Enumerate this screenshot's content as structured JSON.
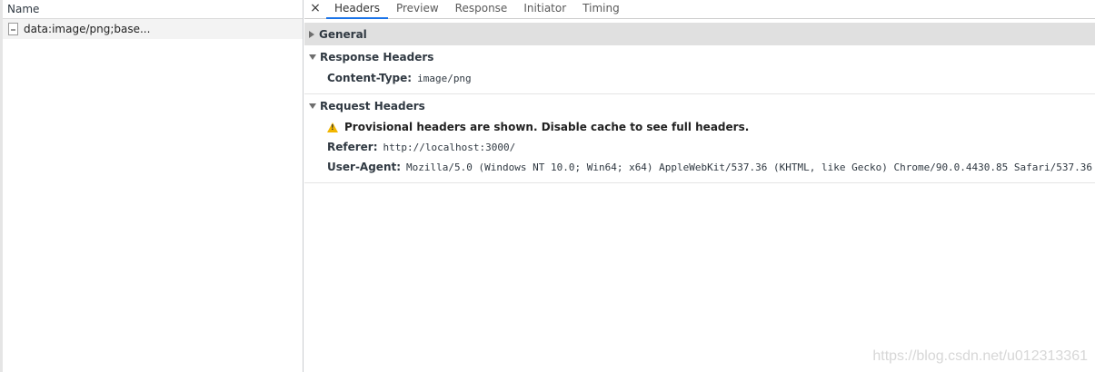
{
  "list": {
    "column_header": "Name",
    "rows": [
      {
        "name": "data:image/png;base..."
      }
    ]
  },
  "detail": {
    "close_glyph": "×",
    "tabs": [
      {
        "label": "Headers",
        "active": true
      },
      {
        "label": "Preview"
      },
      {
        "label": "Response"
      },
      {
        "label": "Initiator"
      },
      {
        "label": "Timing"
      }
    ],
    "general": {
      "title": "General"
    },
    "response_headers": {
      "title": "Response Headers",
      "items": [
        {
          "key": "Content-Type:",
          "value": "image/png"
        }
      ]
    },
    "request_headers": {
      "title": "Request Headers",
      "warning": "Provisional headers are shown. Disable cache to see full headers.",
      "items": [
        {
          "key": "Referer:",
          "value": "http://localhost:3000/"
        },
        {
          "key": "User-Agent:",
          "value": "Mozilla/5.0 (Windows NT 10.0; Win64; x64) AppleWebKit/537.36 (KHTML, like Gecko) Chrome/90.0.4430.85 Safari/537.36"
        }
      ]
    }
  },
  "watermark": "https://blog.csdn.net/u012313361",
  "colors": {
    "active_tab_underline": "#1a73e8",
    "warning": "#f2b600",
    "general_bg": "#e0e0e0"
  }
}
